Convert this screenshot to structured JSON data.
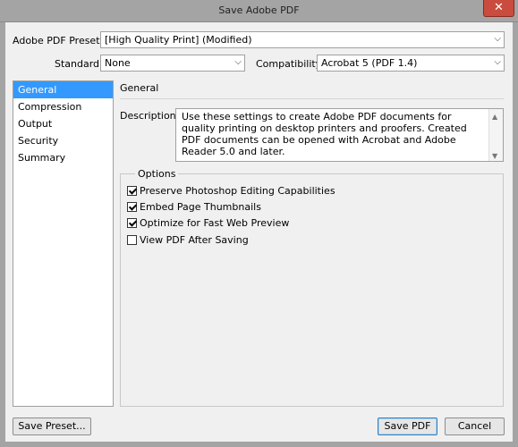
{
  "window": {
    "title": "Save Adobe PDF",
    "close_glyph": "✕"
  },
  "preset": {
    "label": "Adobe PDF Preset:",
    "value": "[High Quality Print] (Modified)"
  },
  "standard": {
    "label": "Standard:",
    "value": "None"
  },
  "compatibility": {
    "label": "Compatibility:",
    "value": "Acrobat 5 (PDF 1.4)"
  },
  "sidebar": {
    "items": [
      {
        "label": "General",
        "selected": true
      },
      {
        "label": "Compression",
        "selected": false
      },
      {
        "label": "Output",
        "selected": false
      },
      {
        "label": "Security",
        "selected": false
      },
      {
        "label": "Summary",
        "selected": false
      }
    ]
  },
  "panel": {
    "title": "General",
    "description_label": "Description:",
    "description": "Use these settings to create Adobe PDF documents for quality printing on desktop printers and proofers.  Created PDF documents can be opened with Acrobat and Adobe Reader 5.0 and later."
  },
  "options": {
    "legend": "Options",
    "items": [
      {
        "label": "Preserve Photoshop Editing Capabilities",
        "checked": true
      },
      {
        "label": "Embed Page Thumbnails",
        "checked": true
      },
      {
        "label": "Optimize for Fast Web Preview",
        "checked": true
      },
      {
        "label": "View PDF After Saving",
        "checked": false
      }
    ]
  },
  "buttons": {
    "save_preset": "Save Preset...",
    "save_pdf": "Save PDF",
    "cancel": "Cancel"
  },
  "icons": {
    "dropdown": "chevron-down-icon",
    "check": "checkmark-icon"
  },
  "colors": {
    "selection": "#3399ff",
    "close": "#c94c3e"
  }
}
